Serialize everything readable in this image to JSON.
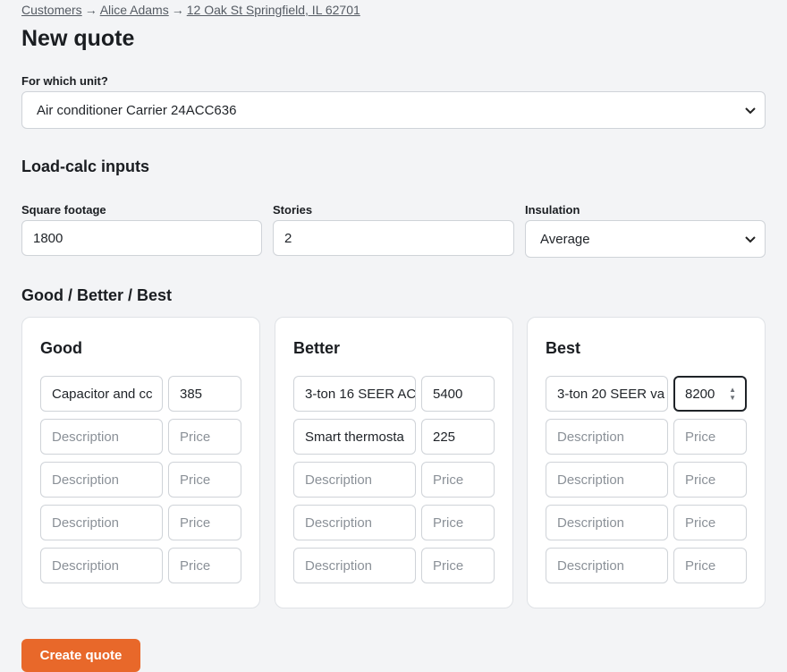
{
  "breadcrumb": {
    "items": [
      "Customers",
      "Alice Adams",
      "12 Oak St Springfield, IL 62701"
    ],
    "separator": "→"
  },
  "page_title": "New quote",
  "unit": {
    "label": "For which unit?",
    "selected": "Air conditioner Carrier 24ACC636"
  },
  "load_calc": {
    "heading": "Load-calc inputs",
    "square_footage": {
      "label": "Square footage",
      "value": "1800"
    },
    "stories": {
      "label": "Stories",
      "value": "2"
    },
    "insulation": {
      "label": "Insulation",
      "selected": "Average"
    }
  },
  "tiers": {
    "heading": "Good / Better / Best",
    "desc_placeholder": "Description",
    "price_placeholder": "Price",
    "cards": [
      {
        "name": "Good",
        "items": [
          {
            "description": "Capacitor and cc",
            "price": "385"
          },
          {
            "description": "",
            "price": ""
          },
          {
            "description": "",
            "price": ""
          },
          {
            "description": "",
            "price": ""
          },
          {
            "description": "",
            "price": ""
          }
        ]
      },
      {
        "name": "Better",
        "items": [
          {
            "description": "3-ton 16 SEER AC",
            "price": "5400"
          },
          {
            "description": "Smart thermosta",
            "price": "225"
          },
          {
            "description": "",
            "price": ""
          },
          {
            "description": "",
            "price": ""
          },
          {
            "description": "",
            "price": ""
          }
        ]
      },
      {
        "name": "Best",
        "items": [
          {
            "description": "3-ton 20 SEER va",
            "price": "8200"
          },
          {
            "description": "",
            "price": ""
          },
          {
            "description": "",
            "price": ""
          },
          {
            "description": "",
            "price": ""
          },
          {
            "description": "",
            "price": ""
          }
        ]
      }
    ]
  },
  "actions": {
    "create_label": "Create quote"
  },
  "icons": {
    "dropdown": "chevron-down-icon",
    "spinner": "number-stepper-icon"
  },
  "colors": {
    "accent": "#e8682a",
    "background": "#f3f4f6"
  }
}
